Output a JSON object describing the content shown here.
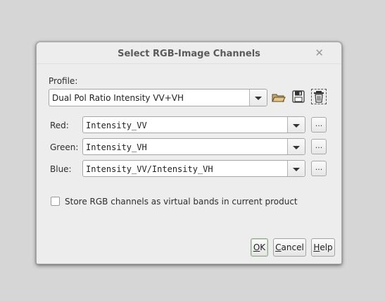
{
  "dialog": {
    "title": "Select RGB-Image Channels",
    "close_glyph": "✕"
  },
  "profile": {
    "label": "Profile:",
    "value": "Dual Pol Ratio Intensity VV+VH",
    "icons": [
      "open-folder-icon",
      "save-disk-icon",
      "delete-trash-icon"
    ]
  },
  "channels": [
    {
      "label": "Red:",
      "value": "Intensity_VV",
      "browse": "..."
    },
    {
      "label": "Green:",
      "value": "Intensity_VH",
      "browse": "..."
    },
    {
      "label": "Blue:",
      "value": "Intensity_VV/Intensity_VH",
      "browse": "..."
    }
  ],
  "options": {
    "virtual_bands_label": "Store RGB channels as virtual bands in current product",
    "virtual_bands_checked": false
  },
  "buttons": {
    "ok_mn": "O",
    "ok_rest": "K",
    "cancel_mn": "C",
    "cancel_rest": "ancel",
    "help_mn": "H",
    "help_rest": "elp"
  }
}
